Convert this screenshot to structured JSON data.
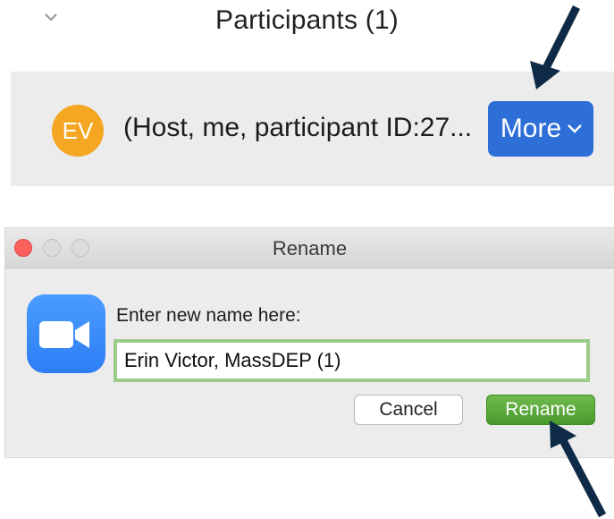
{
  "participants_panel": {
    "title": "Participants (1)",
    "collapse_icon": "chevron-down-icon",
    "participant": {
      "initials": "EV",
      "avatar_color": "#f5a623",
      "name": "(Host, me, participant ID:27..."
    },
    "more_button": {
      "label": "More",
      "icon": "chevron-down-icon",
      "color": "#2d6fd6"
    }
  },
  "rename_dialog": {
    "title": "Rename",
    "app_icon": "zoom-camera-icon",
    "prompt": "Enter new name here:",
    "name_value": "Erin Victor, MassDEP (1)",
    "cancel_label": "Cancel",
    "rename_label": "Rename",
    "rename_color": "#5aa83a"
  },
  "annotations": {
    "arrow_color": "#0e2a47"
  }
}
